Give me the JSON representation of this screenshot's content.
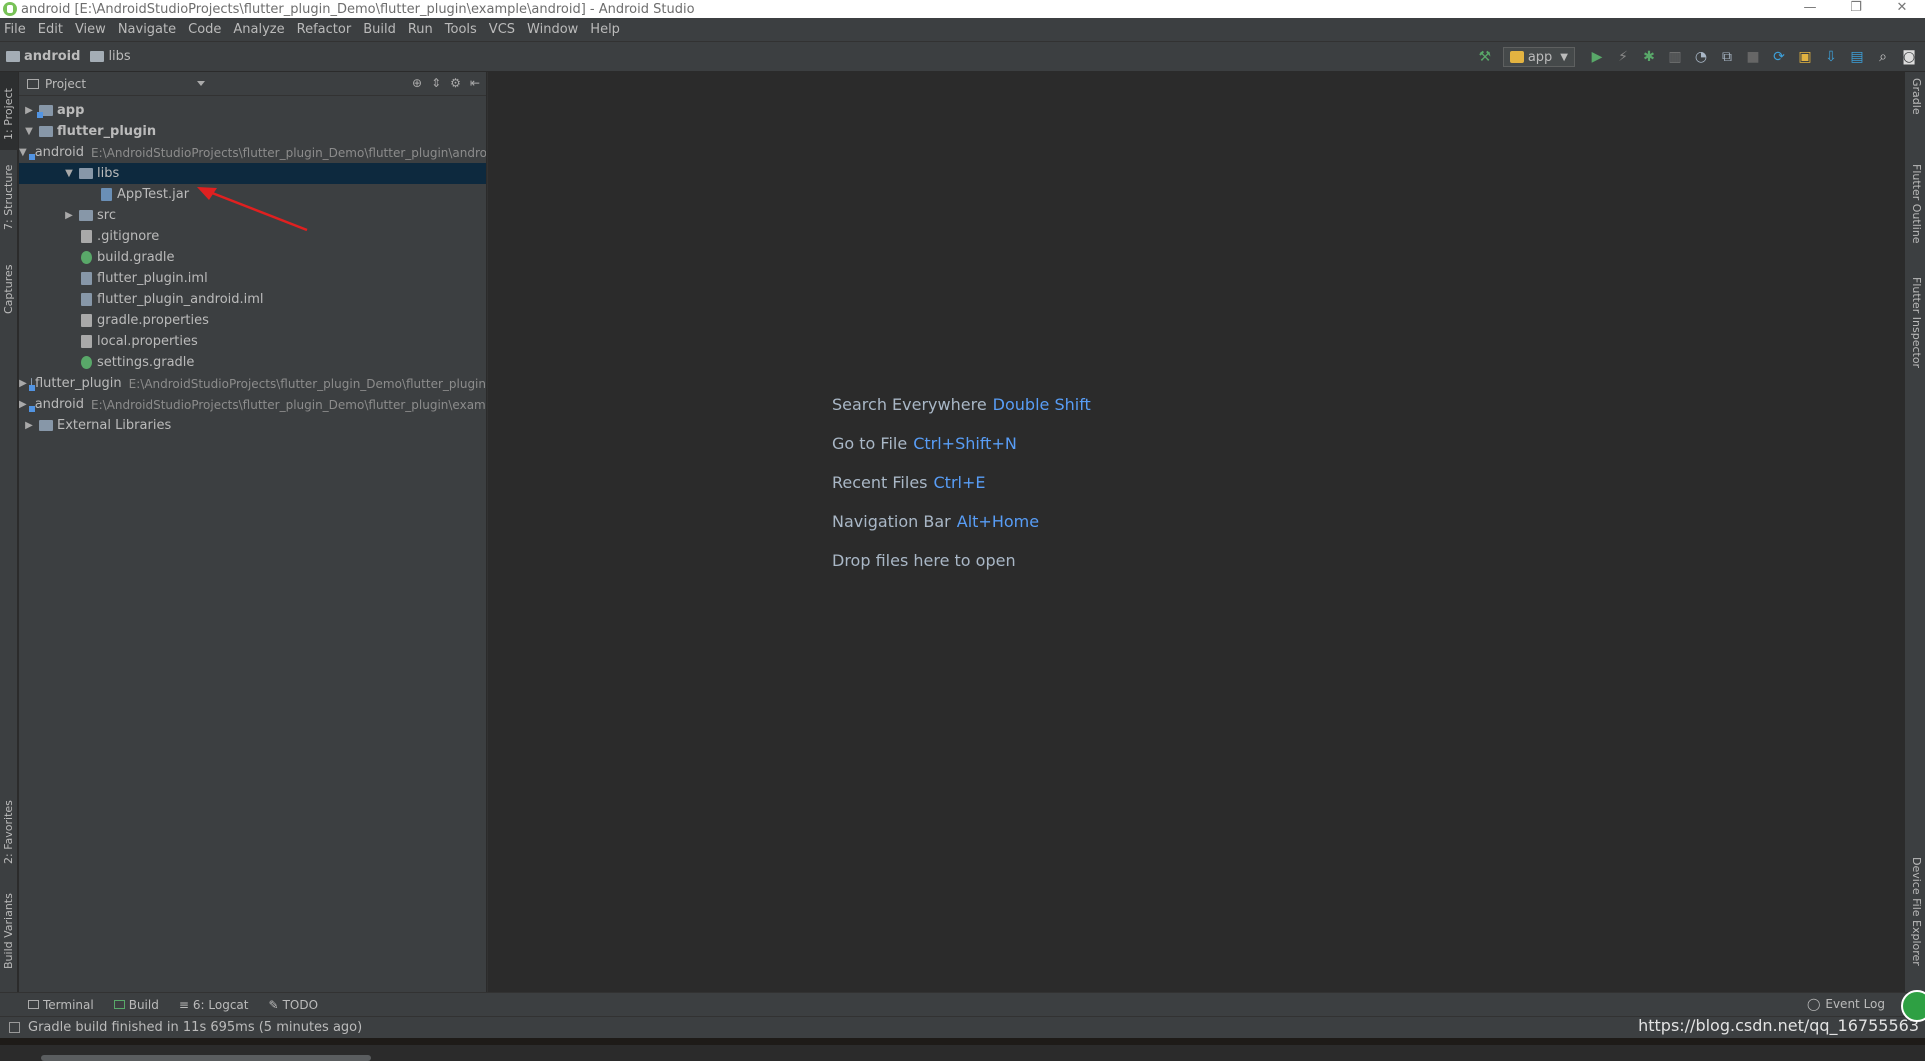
{
  "window": {
    "title": "android [E:\\AndroidStudioProjects\\flutter_plugin_Demo\\flutter_plugin\\example\\android] - Android Studio",
    "controls": [
      "—",
      "❐",
      "✕"
    ]
  },
  "menu": [
    "File",
    "Edit",
    "View",
    "Navigate",
    "Code",
    "Analyze",
    "Refactor",
    "Build",
    "Run",
    "Tools",
    "VCS",
    "Window",
    "Help"
  ],
  "breadcrumb": [
    "android",
    "libs"
  ],
  "toolbar": {
    "run_config": "app",
    "icons": [
      "hammer-icon",
      "run-icon",
      "apply-changes-icon",
      "debug-icon",
      "coverage-icon",
      "profile-icon",
      "attach-debugger-icon",
      "stop-icon",
      "sync-gradle-icon",
      "avd-manager-icon",
      "sdk-manager-icon",
      "project-structure-icon",
      "search-icon",
      "user-icon"
    ]
  },
  "left_tool_windows": [
    "1: Project",
    "7: Structure",
    "Captures",
    "2: Favorites",
    "Build Variants"
  ],
  "right_tool_windows": [
    "Gradle",
    "Flutter Outline",
    "Flutter Inspector",
    "Device File Explorer"
  ],
  "project_panel": {
    "header": "Project",
    "tree": [
      {
        "label": "app",
        "bold": true,
        "arrow": "▶",
        "type": "module",
        "depth": 0
      },
      {
        "label": "flutter_plugin",
        "bold": true,
        "arrow": "▼",
        "type": "folder",
        "depth": 0
      },
      {
        "label": "android",
        "path": "E:\\AndroidStudioProjects\\flutter_plugin_Demo\\flutter_plugin\\android",
        "arrow": "▼",
        "type": "module",
        "depth": 1
      },
      {
        "label": "libs",
        "arrow": "▼",
        "type": "folder",
        "depth": 2,
        "selected": true
      },
      {
        "label": "AppTest.jar",
        "arrow": "",
        "type": "jar",
        "depth": 3
      },
      {
        "label": "src",
        "arrow": "▶",
        "type": "folder",
        "depth": 2
      },
      {
        "label": ".gitignore",
        "arrow": "",
        "type": "text",
        "depth": 2
      },
      {
        "label": "build.gradle",
        "arrow": "",
        "type": "gradle",
        "depth": 2
      },
      {
        "label": "flutter_plugin.iml",
        "arrow": "",
        "type": "iml",
        "depth": 2
      },
      {
        "label": "flutter_plugin_android.iml",
        "arrow": "",
        "type": "iml",
        "depth": 2
      },
      {
        "label": "gradle.properties",
        "arrow": "",
        "type": "props",
        "depth": 2
      },
      {
        "label": "local.properties",
        "arrow": "",
        "type": "props",
        "depth": 2
      },
      {
        "label": "settings.gradle",
        "arrow": "",
        "type": "gradle",
        "depth": 2
      },
      {
        "label": "flutter_plugin",
        "path": "E:\\AndroidStudioProjects\\flutter_plugin_Demo\\flutter_plugin",
        "arrow": "▶",
        "type": "module",
        "depth": 1
      },
      {
        "label": "android",
        "path": "E:\\AndroidStudioProjects\\flutter_plugin_Demo\\flutter_plugin\\example",
        "arrow": "▶",
        "type": "module",
        "depth": 0
      },
      {
        "label": "External Libraries",
        "arrow": "▶",
        "type": "libs",
        "depth": 0
      }
    ]
  },
  "editor_hints": [
    {
      "text": "Search Everywhere",
      "key": "Double Shift"
    },
    {
      "text": "Go to File",
      "key": "Ctrl+Shift+N"
    },
    {
      "text": "Recent Files",
      "key": "Ctrl+E"
    },
    {
      "text": "Navigation Bar",
      "key": "Alt+Home"
    },
    {
      "text": "Drop files here to open",
      "key": ""
    }
  ],
  "bottom_tabs": [
    "Terminal",
    "Build",
    "6: Logcat",
    "TODO"
  ],
  "event_log": "Event Log",
  "status": "Gradle build finished in 11s 695ms (5 minutes ago)",
  "watermark": "https://blog.csdn.net/qq_16755563",
  "colors": {
    "bg": "#2b2b2b",
    "panel": "#3c3f41",
    "accent": "#589df6",
    "selection": "#0d293e",
    "annotation_arrow": "#e02020"
  }
}
